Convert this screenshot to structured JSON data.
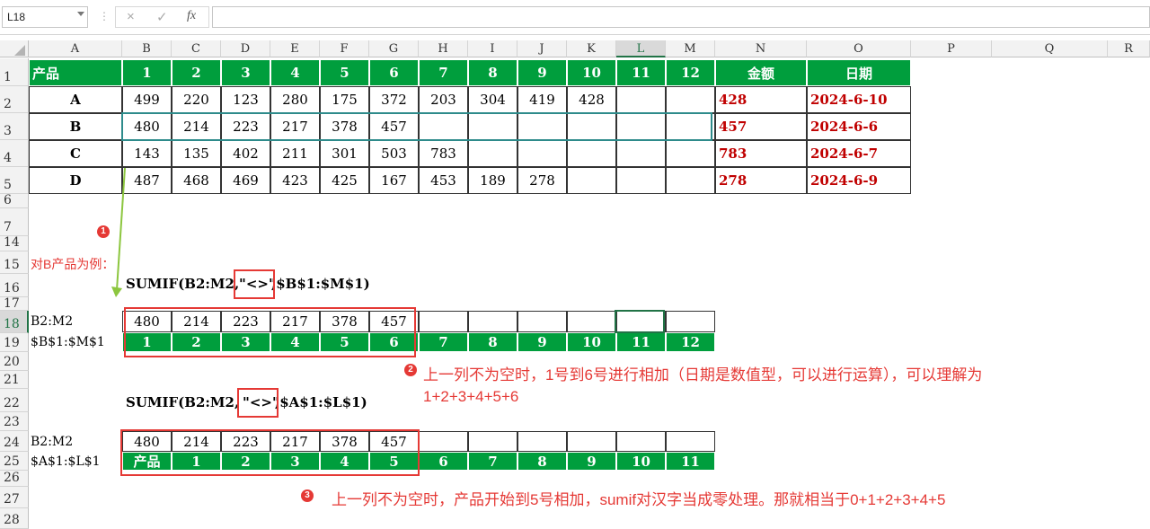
{
  "name_box": "L18",
  "formula_bar": {
    "cancel_icon": "×",
    "enter_icon": "✓",
    "fx_label": "fx",
    "value": ""
  },
  "columns": [
    "A",
    "B",
    "C",
    "D",
    "E",
    "F",
    "G",
    "H",
    "I",
    "J",
    "K",
    "L",
    "M",
    "N",
    "O",
    "P",
    "Q",
    "R"
  ],
  "rows": [
    "1",
    "2",
    "3",
    "4",
    "5",
    "6",
    "7",
    "14",
    "15",
    "16",
    "17",
    "18",
    "19",
    "20",
    "21",
    "22",
    "23",
    "24",
    "25",
    "26",
    "27",
    "28"
  ],
  "table": {
    "header": [
      "产品",
      "1",
      "2",
      "3",
      "4",
      "5",
      "6",
      "7",
      "8",
      "9",
      "10",
      "11",
      "12",
      "金额",
      "日期"
    ],
    "rows": [
      {
        "product": "A",
        "values": [
          "499",
          "220",
          "123",
          "280",
          "175",
          "372",
          "203",
          "304",
          "419",
          "428",
          "",
          ""
        ],
        "amount": "428",
        "date": "2024-6-10"
      },
      {
        "product": "B",
        "values": [
          "480",
          "214",
          "223",
          "217",
          "378",
          "457",
          "",
          "",
          "",
          "",
          "",
          ""
        ],
        "amount": "457",
        "date": "2024-6-6"
      },
      {
        "product": "C",
        "values": [
          "143",
          "135",
          "402",
          "211",
          "301",
          "503",
          "783",
          "",
          "",
          "",
          "",
          ""
        ],
        "amount": "783",
        "date": "2024-6-7"
      },
      {
        "product": "D",
        "values": [
          "487",
          "468",
          "469",
          "423",
          "425",
          "167",
          "453",
          "189",
          "278",
          "",
          "",
          ""
        ],
        "amount": "278",
        "date": "2024-6-9"
      }
    ]
  },
  "annotations": {
    "badge1": "1",
    "example_label": "对B产品为例：",
    "formula1_pre": "SUMIF(B2:M2,",
    "formula1_crit": "\"<>\"",
    "formula1_post": ",$B$1:$M$1)",
    "formula2_pre": "SUMIF(B2:M2,",
    "formula2_crit": "\"<>\"",
    "formula2_post": ",$A$1:$L$1)",
    "demo1": {
      "label_top": "B2:M2",
      "label_bottom": "$B$1:$M$1",
      "values": [
        "480",
        "214",
        "223",
        "217",
        "378",
        "457",
        "",
        "",
        "",
        "",
        "",
        ""
      ],
      "headers": [
        "1",
        "2",
        "3",
        "4",
        "5",
        "6",
        "7",
        "8",
        "9",
        "10",
        "11",
        "12"
      ]
    },
    "demo2": {
      "label_top": "B2:M2",
      "label_bottom": "$A$1:$L$1",
      "values": [
        "480",
        "214",
        "223",
        "217",
        "378",
        "457",
        "",
        "",
        "",
        "",
        "",
        ""
      ],
      "headers": [
        "产品",
        "1",
        "2",
        "3",
        "4",
        "5",
        "6",
        "7",
        "8",
        "9",
        "10",
        "11"
      ]
    },
    "badge2": "2",
    "note2_line1": "上一列不为空时，1号到6号进行相加（日期是数值型，可以进行运算），可以理解为",
    "note2_line2": "1+2+3+4+5+6",
    "badge3": "3",
    "note3": "上一列不为空时，产品开始到5号相加，sumif对汉字当成零处理。那就相当于0+1+2+3+4+5"
  },
  "colors": {
    "green": "#009e3d",
    "red": "#c00000",
    "annotation": "#e53935",
    "teal_selection": "#2e8b8b",
    "arrow": "#8cc63f"
  }
}
